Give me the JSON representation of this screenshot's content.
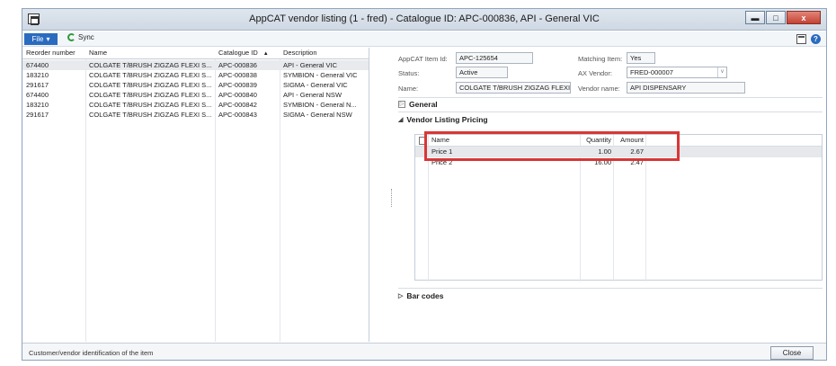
{
  "window": {
    "title": "AppCAT vendor listing (1 - fred) - Catalogue ID: APC-000836, API - General VIC",
    "buttons": {
      "minimize": "▬",
      "maximize": "□",
      "close": "x"
    }
  },
  "menubar": {
    "file_label": "File",
    "file_arrow": "▾",
    "sync_label": "Sync",
    "help_label": "?"
  },
  "left_grid": {
    "columns": [
      "Reorder number",
      "Name",
      "Catalogue ID",
      "Description"
    ],
    "sort_indicator": "▲",
    "rows": [
      [
        "674400",
        "COLGATE T/BRUSH ZIGZAG FLEXI S...",
        "APC-000836",
        "API - General VIC"
      ],
      [
        "183210",
        "COLGATE T/BRUSH ZIGZAG FLEXI S...",
        "APC-000838",
        "SYMBION - General VIC"
      ],
      [
        "291617",
        "COLGATE T/BRUSH ZIGZAG FLEXI S...",
        "APC-000839",
        "SIGMA - General VIC"
      ],
      [
        "674400",
        "COLGATE T/BRUSH ZIGZAG FLEXI S...",
        "APC-000840",
        "API - General NSW"
      ],
      [
        "183210",
        "COLGATE T/BRUSH ZIGZAG FLEXI S...",
        "APC-000842",
        "SYMBION - General N..."
      ],
      [
        "291617",
        "COLGATE T/BRUSH ZIGZAG FLEXI S...",
        "APC-000843",
        "SIGMA - General NSW"
      ]
    ]
  },
  "details": {
    "item_id_label": "AppCAT Item Id:",
    "item_id": "APC-125654",
    "matching_label": "Matching Item:",
    "matching": "Yes",
    "status_label": "Status:",
    "status": "Active",
    "vendor_label": "AX Vendor:",
    "vendor": "FRED-000007",
    "vendor_arrow": "v",
    "name_label": "Name:",
    "name": "COLGATE T/BRUSH ZIGZAG FLEXI",
    "vendor_name_label": "Vendor name:",
    "vendor_name": "API DISPENSARY"
  },
  "sections": {
    "general": "General",
    "general_marker": "▷",
    "pricing": "Vendor Listing Pricing",
    "pricing_marker": "◢",
    "barcodes": "Bar codes",
    "barcodes_marker": "▷"
  },
  "pricing_grid": {
    "columns": [
      "Name",
      "Quantity",
      "Amount"
    ],
    "rows": [
      [
        "Price 1",
        "1.00",
        "2.67"
      ],
      [
        "Price 2",
        "16.00",
        "2.47"
      ]
    ]
  },
  "statusbar": {
    "text": "Customer/vendor identification of the item",
    "close_label": "Close"
  }
}
